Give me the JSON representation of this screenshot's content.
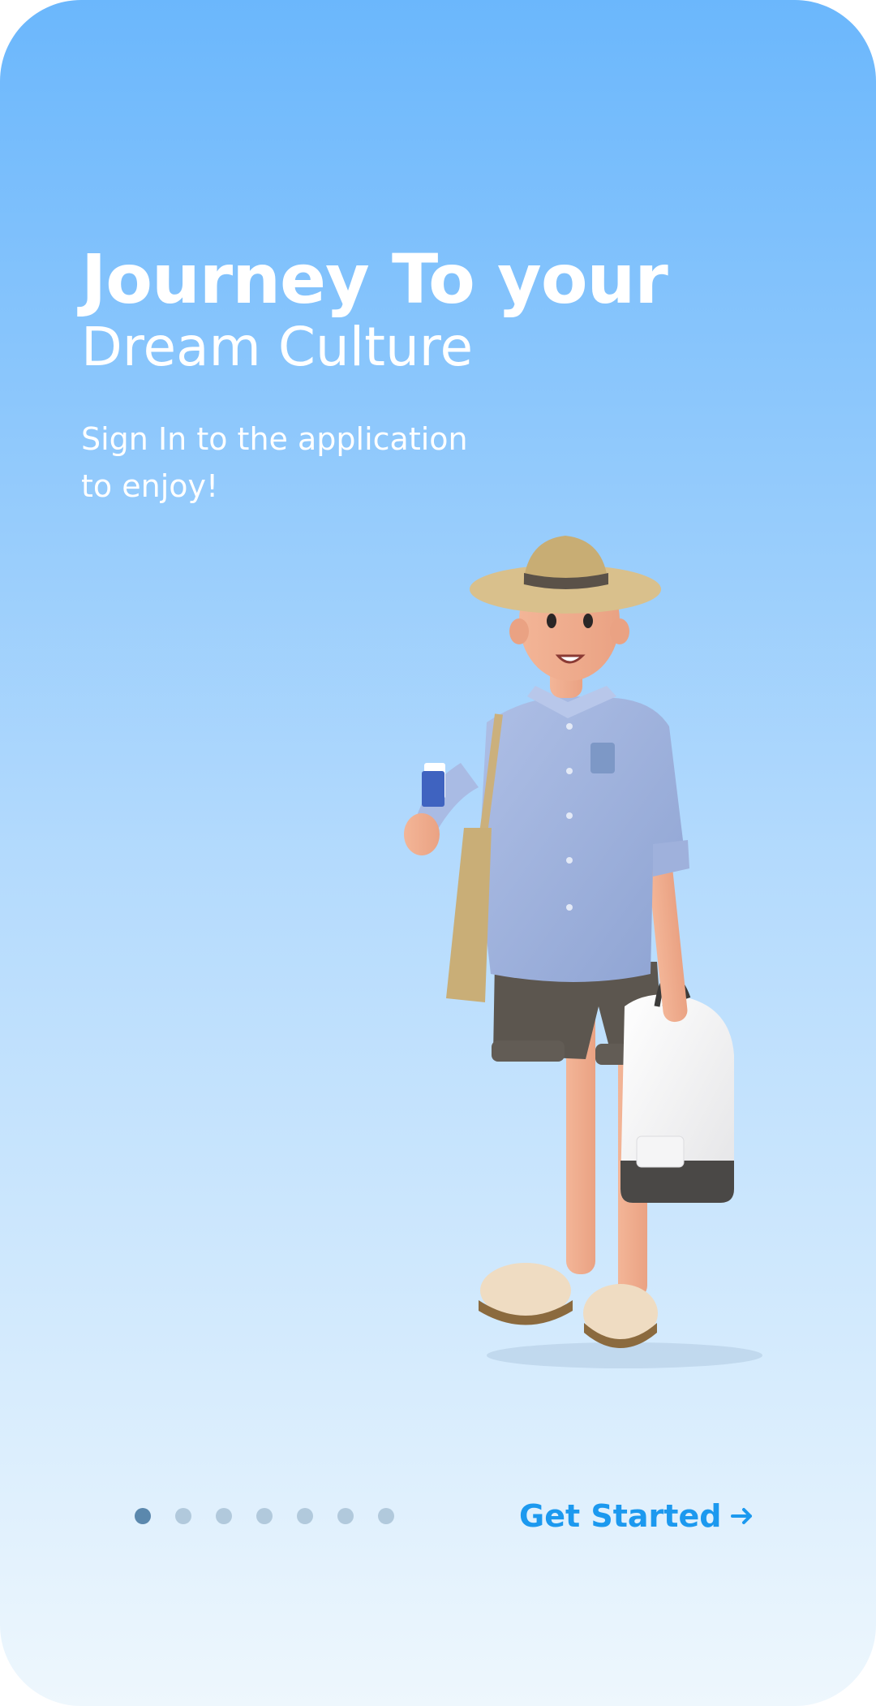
{
  "onboarding": {
    "title_line1": "Journey To your",
    "title_line2": "Dream Culture",
    "subtitle_line1": "Sign In to the application",
    "subtitle_line2": "to enjoy!",
    "illustration_icon": "traveler-illustration-icon",
    "pager": {
      "total": 7,
      "current": 1
    },
    "cta_label": "Get Started",
    "cta_icon": "arrow-right-icon"
  },
  "colors": {
    "gradient_top": "#6bb7fc",
    "gradient_bottom": "#eef7fd",
    "text_primary": "#ffffff",
    "accent": "#1c99ef",
    "dot_active": "#5b88ad",
    "dot_inactive": "#b1c9dc"
  }
}
